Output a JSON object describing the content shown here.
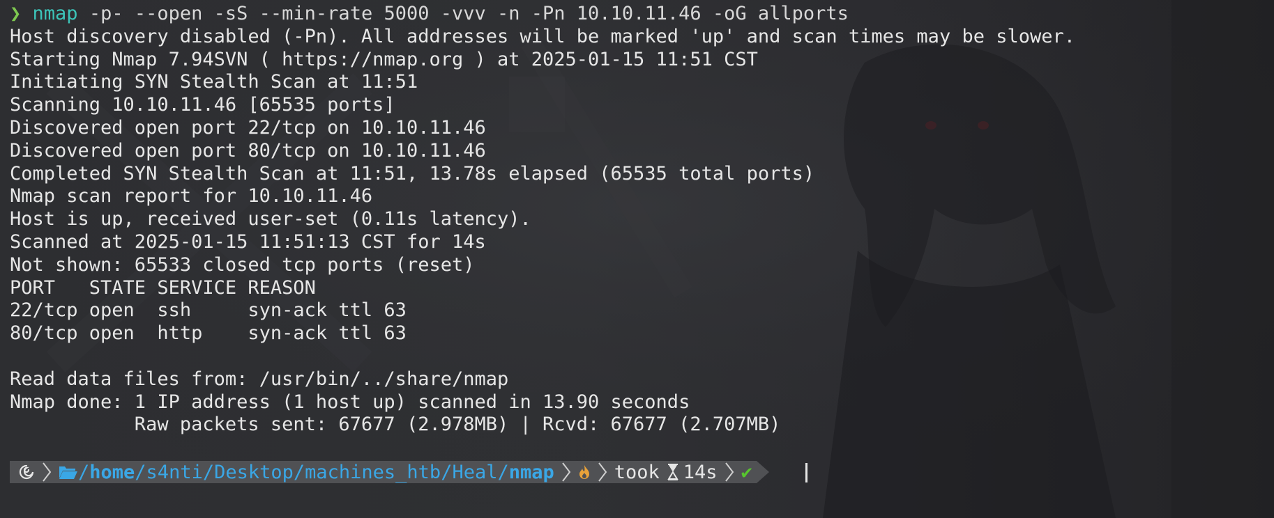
{
  "command": {
    "prompt_symbol": "❯",
    "program": "nmap",
    "args": " -p- --open -sS --min-rate 5000 -vvv -n -Pn 10.10.11.46 -oG allports"
  },
  "output": [
    "Host discovery disabled (-Pn). All addresses will be marked 'up' and scan times may be slower.",
    "Starting Nmap 7.94SVN ( https://nmap.org ) at 2025-01-15 11:51 CST",
    "Initiating SYN Stealth Scan at 11:51",
    "Scanning 10.10.11.46 [65535 ports]",
    "Discovered open port 22/tcp on 10.10.11.46",
    "Discovered open port 80/tcp on 10.10.11.46",
    "Completed SYN Stealth Scan at 11:51, 13.78s elapsed (65535 total ports)",
    "Nmap scan report for 10.10.11.46",
    "Host is up, received user-set (0.11s latency).",
    "Scanned at 2025-01-15 11:51:13 CST for 14s",
    "Not shown: 65533 closed tcp ports (reset)",
    "PORT   STATE SERVICE REASON",
    "22/tcp open  ssh     syn-ack ttl 63",
    "80/tcp open  http    syn-ack ttl 63",
    "",
    "Read data files from: /usr/bin/../share/nmap",
    "Nmap done: 1 IP address (1 host up) scanned in 13.90 seconds",
    "           Raw packets sent: 67677 (2.978MB) | Rcvd: 67677 (2.707MB)"
  ],
  "prompt": {
    "os_icon": "debian-swirl-icon",
    "folder_icon": "folder-open-icon",
    "path_prefix": "/",
    "path_home": "home",
    "path_middle": "/s4nti/Desktop/machines_htb/Heal/",
    "path_current": "nmap",
    "git_icon": "flame-icon",
    "took_label": "took",
    "hourglass_icon": "hourglass-icon",
    "duration": "14s",
    "status_icon": "check-icon",
    "status_symbol": "✔"
  },
  "colors": {
    "background": "#2e2f32",
    "text": "#e6e6e6",
    "prompt_green": "#7ec850",
    "command_teal": "#3cc4b8",
    "path_blue": "#3aa7e6",
    "powerline_bg": "#505154",
    "check_green": "#57c52e",
    "flame_orange": "#e8a23a"
  }
}
